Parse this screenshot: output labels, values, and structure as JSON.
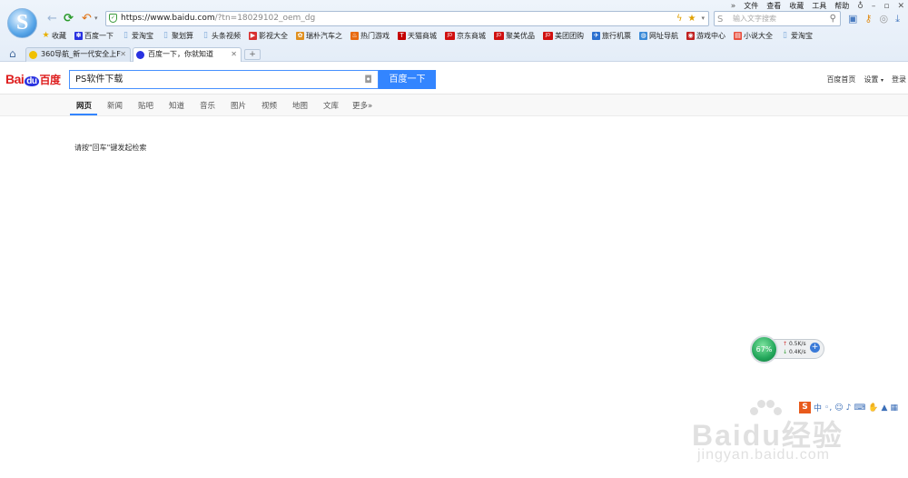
{
  "browser": {
    "menu": [
      "文件",
      "查看",
      "收藏",
      "工具",
      "帮助"
    ],
    "url": {
      "main": "https://www.baidu.com",
      "path": "/?tn=18029102_oem_dg"
    },
    "search_placeholder": "输入文字搜索",
    "bookmarks": [
      {
        "label": "收藏",
        "icon": "star-icon",
        "color": "#e8b000"
      },
      {
        "label": "百度一下",
        "icon": "baidu-paw-icon",
        "color": "#2932e1"
      },
      {
        "label": "爱淘宝",
        "icon": "page-icon",
        "color": "#7aa7d8"
      },
      {
        "label": "聚划算",
        "icon": "page-icon",
        "color": "#7aa7d8"
      },
      {
        "label": "头条视频",
        "icon": "page-icon",
        "color": "#7aa7d8"
      },
      {
        "label": "影视大全",
        "icon": "play-icon",
        "color": "#d83030"
      },
      {
        "label": "瑞朴汽车之",
        "icon": "car-icon",
        "color": "#e09020"
      },
      {
        "label": "热门游戏",
        "icon": "flame-icon",
        "color": "#e86a10"
      },
      {
        "label": "天猫商城",
        "icon": "tmall-icon",
        "color": "#c40000"
      },
      {
        "label": "京东商城",
        "icon": "jd-icon",
        "color": "#d01010"
      },
      {
        "label": "聚美优品",
        "icon": "jd-icon",
        "color": "#d01010"
      },
      {
        "label": "美团团购",
        "icon": "jd-icon",
        "color": "#d01010"
      },
      {
        "label": "旅行机票",
        "icon": "plane-icon",
        "color": "#2a6fd0"
      },
      {
        "label": "网址导航",
        "icon": "globe-icon",
        "color": "#3a8ad8"
      },
      {
        "label": "游戏中心",
        "icon": "game-icon",
        "color": "#c02020"
      },
      {
        "label": "小说大全",
        "icon": "book-icon",
        "color": "#e85040"
      },
      {
        "label": "爱淘宝",
        "icon": "page-icon",
        "color": "#7aa7d8"
      }
    ],
    "tabs": [
      {
        "label": "360导航_新一代安全上F",
        "icon_color": "#f0c000"
      },
      {
        "label": "百度一下，你就知道",
        "icon_color": "#2932e1"
      }
    ],
    "newtab_label": "+",
    "chevron_label": "»"
  },
  "baidu": {
    "logo": {
      "bai": "Bai",
      "du": "du",
      "cn": "百度"
    },
    "query": "PS软件下载",
    "search_button": "百度一下",
    "right_links": [
      "百度首页",
      "设置",
      "登录"
    ],
    "nav": [
      "网页",
      "新闻",
      "贴吧",
      "知道",
      "音乐",
      "图片",
      "视频",
      "地图",
      "文库",
      "更多»"
    ],
    "hint": "请按\"回车\"键发起检索"
  },
  "speed_widget": {
    "percent": "67%",
    "up": "0.5K/s",
    "down": "0.4K/s"
  },
  "watermark": {
    "word": "Baidu经验",
    "sub": "jingyan.baidu.com"
  }
}
